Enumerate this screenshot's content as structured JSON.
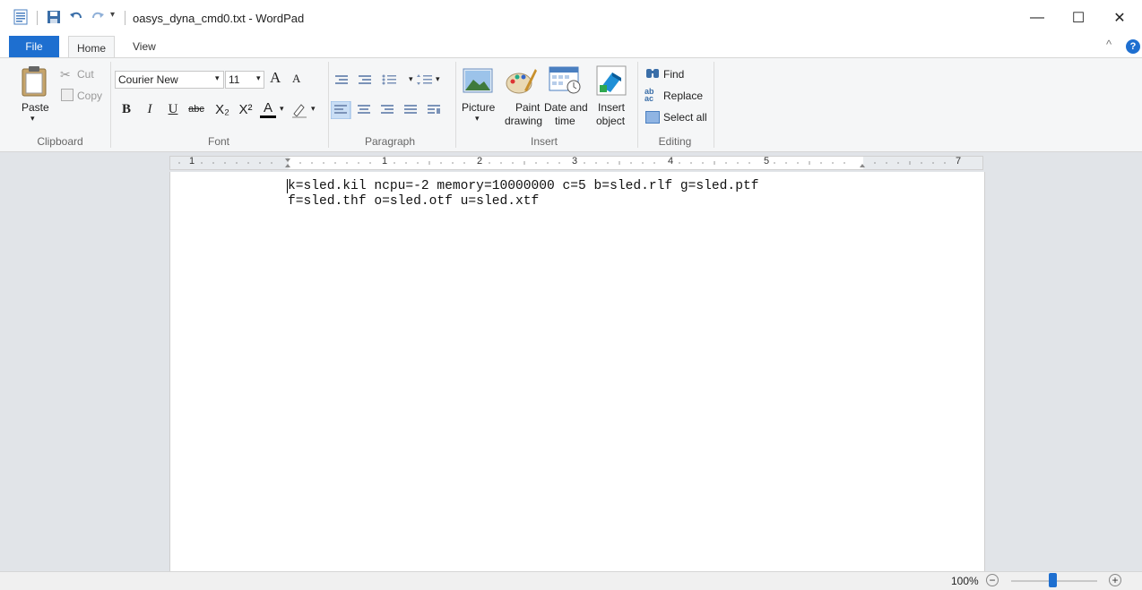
{
  "window": {
    "title": "oasys_dyna_cmd0.txt - WordPad",
    "minimize_glyph": "—",
    "maximize_glyph": "☐",
    "close_glyph": "✕",
    "qat_dropdown_glyph": "▾"
  },
  "tabs": {
    "file": "File",
    "home": "Home",
    "view": "View",
    "collapse_glyph": "^",
    "help_glyph": "?"
  },
  "ribbon": {
    "clipboard": {
      "paste": "Paste",
      "cut": "Cut",
      "copy": "Copy",
      "label": "Clipboard"
    },
    "font": {
      "family": "Courier New",
      "size": "11",
      "label": "Font",
      "bold": "B",
      "italic": "I",
      "underline": "U",
      "strike": "abc",
      "subscript": "X₂",
      "superscript": "X²",
      "color": "A",
      "grow": "A",
      "shrink": "A"
    },
    "paragraph": {
      "label": "Paragraph"
    },
    "insert": {
      "picture": "Picture",
      "paint_1": "Paint",
      "paint_2": "drawing",
      "date_1": "Date and",
      "date_2": "time",
      "object_1": "Insert",
      "object_2": "object",
      "label": "Insert"
    },
    "editing": {
      "find": "Find",
      "replace": "Replace",
      "select_all": "Select all",
      "label": "Editing"
    }
  },
  "ruler": {
    "numbers": [
      "1",
      "1",
      "2",
      "3",
      "4",
      "5",
      "7"
    ]
  },
  "document": {
    "text": "k=sled.kil ncpu=-2 memory=10000000 c=5 b=sled.rlf g=sled.ptf\nf=sled.thf o=sled.otf u=sled.xtf"
  },
  "status": {
    "zoom": "100%",
    "zoom_out": "−",
    "zoom_in": "+"
  },
  "colors": {
    "accent": "#1e6fd0",
    "ribbon_bg": "#f5f6f7",
    "doc_bg": "#e1e4e8"
  }
}
